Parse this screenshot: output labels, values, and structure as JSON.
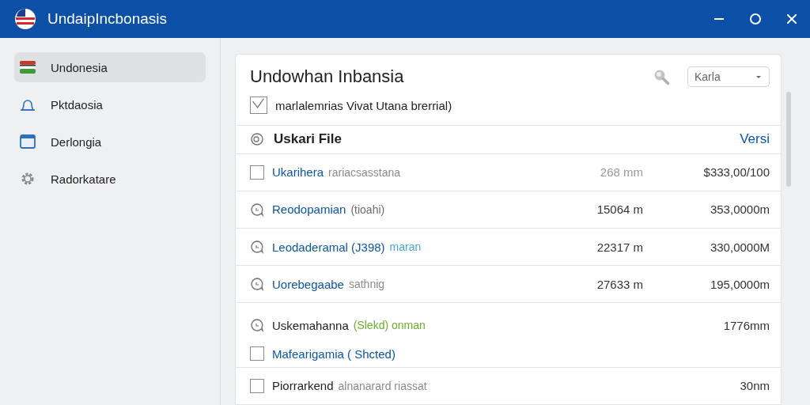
{
  "window": {
    "title": "UndaipIncbonasis"
  },
  "sidebar": {
    "items": [
      {
        "label": "Undonesia",
        "selected": true
      },
      {
        "label": "Pktdaosia",
        "selected": false
      },
      {
        "label": "Derlongia",
        "selected": false
      },
      {
        "label": "Radorkatare",
        "selected": false
      }
    ]
  },
  "panel": {
    "title": "Undowhan Inbansia",
    "dropdown": {
      "value": "Karla"
    },
    "option": {
      "label": "marlalemrias Vivat Utana brerrial)",
      "checked": true
    },
    "section": {
      "title": "Uskari File",
      "link": "Versi"
    },
    "rows": [
      {
        "kind": "checkbox",
        "checked": false,
        "name": "Ukarihera",
        "linked": true,
        "note": "rariacsasstana",
        "color": "#8a8a8a",
        "size": "268 mm",
        "size_muted": true,
        "price": "$333,00/100"
      },
      {
        "kind": "bubble",
        "name": "Reodopamian",
        "linked": true,
        "note": "(tioahi)",
        "color": "#6b6b6b",
        "size": "15064 m",
        "size_muted": false,
        "price": "353,0000m"
      },
      {
        "kind": "bubble",
        "name": "Leodaderamal (J398)",
        "linked": true,
        "note": "maran",
        "color": "#4aa6d8",
        "size": "22317 m",
        "size_muted": false,
        "price": "330,0000M"
      },
      {
        "kind": "bubble",
        "name": "Uorebegaabe",
        "linked": true,
        "note": "sathnig",
        "color": "#8a8a8a",
        "size": "27633 m",
        "size_muted": false,
        "price": "195,0000m"
      },
      {
        "kind": "bubble",
        "name": "Uskemahanna",
        "linked": false,
        "note": "(Slekd) onman",
        "color": "#6cae2e",
        "price": "1776mm"
      },
      {
        "kind": "checkbox",
        "checked": false,
        "name": "Mafearigamia ( Shcted)",
        "linked": true
      },
      {
        "kind": "checkbox",
        "checked": false,
        "name": "Piorrarkend",
        "linked": false,
        "note": "alnanarard riassat",
        "color": "#8a8a8a",
        "price": "30nm"
      }
    ]
  }
}
